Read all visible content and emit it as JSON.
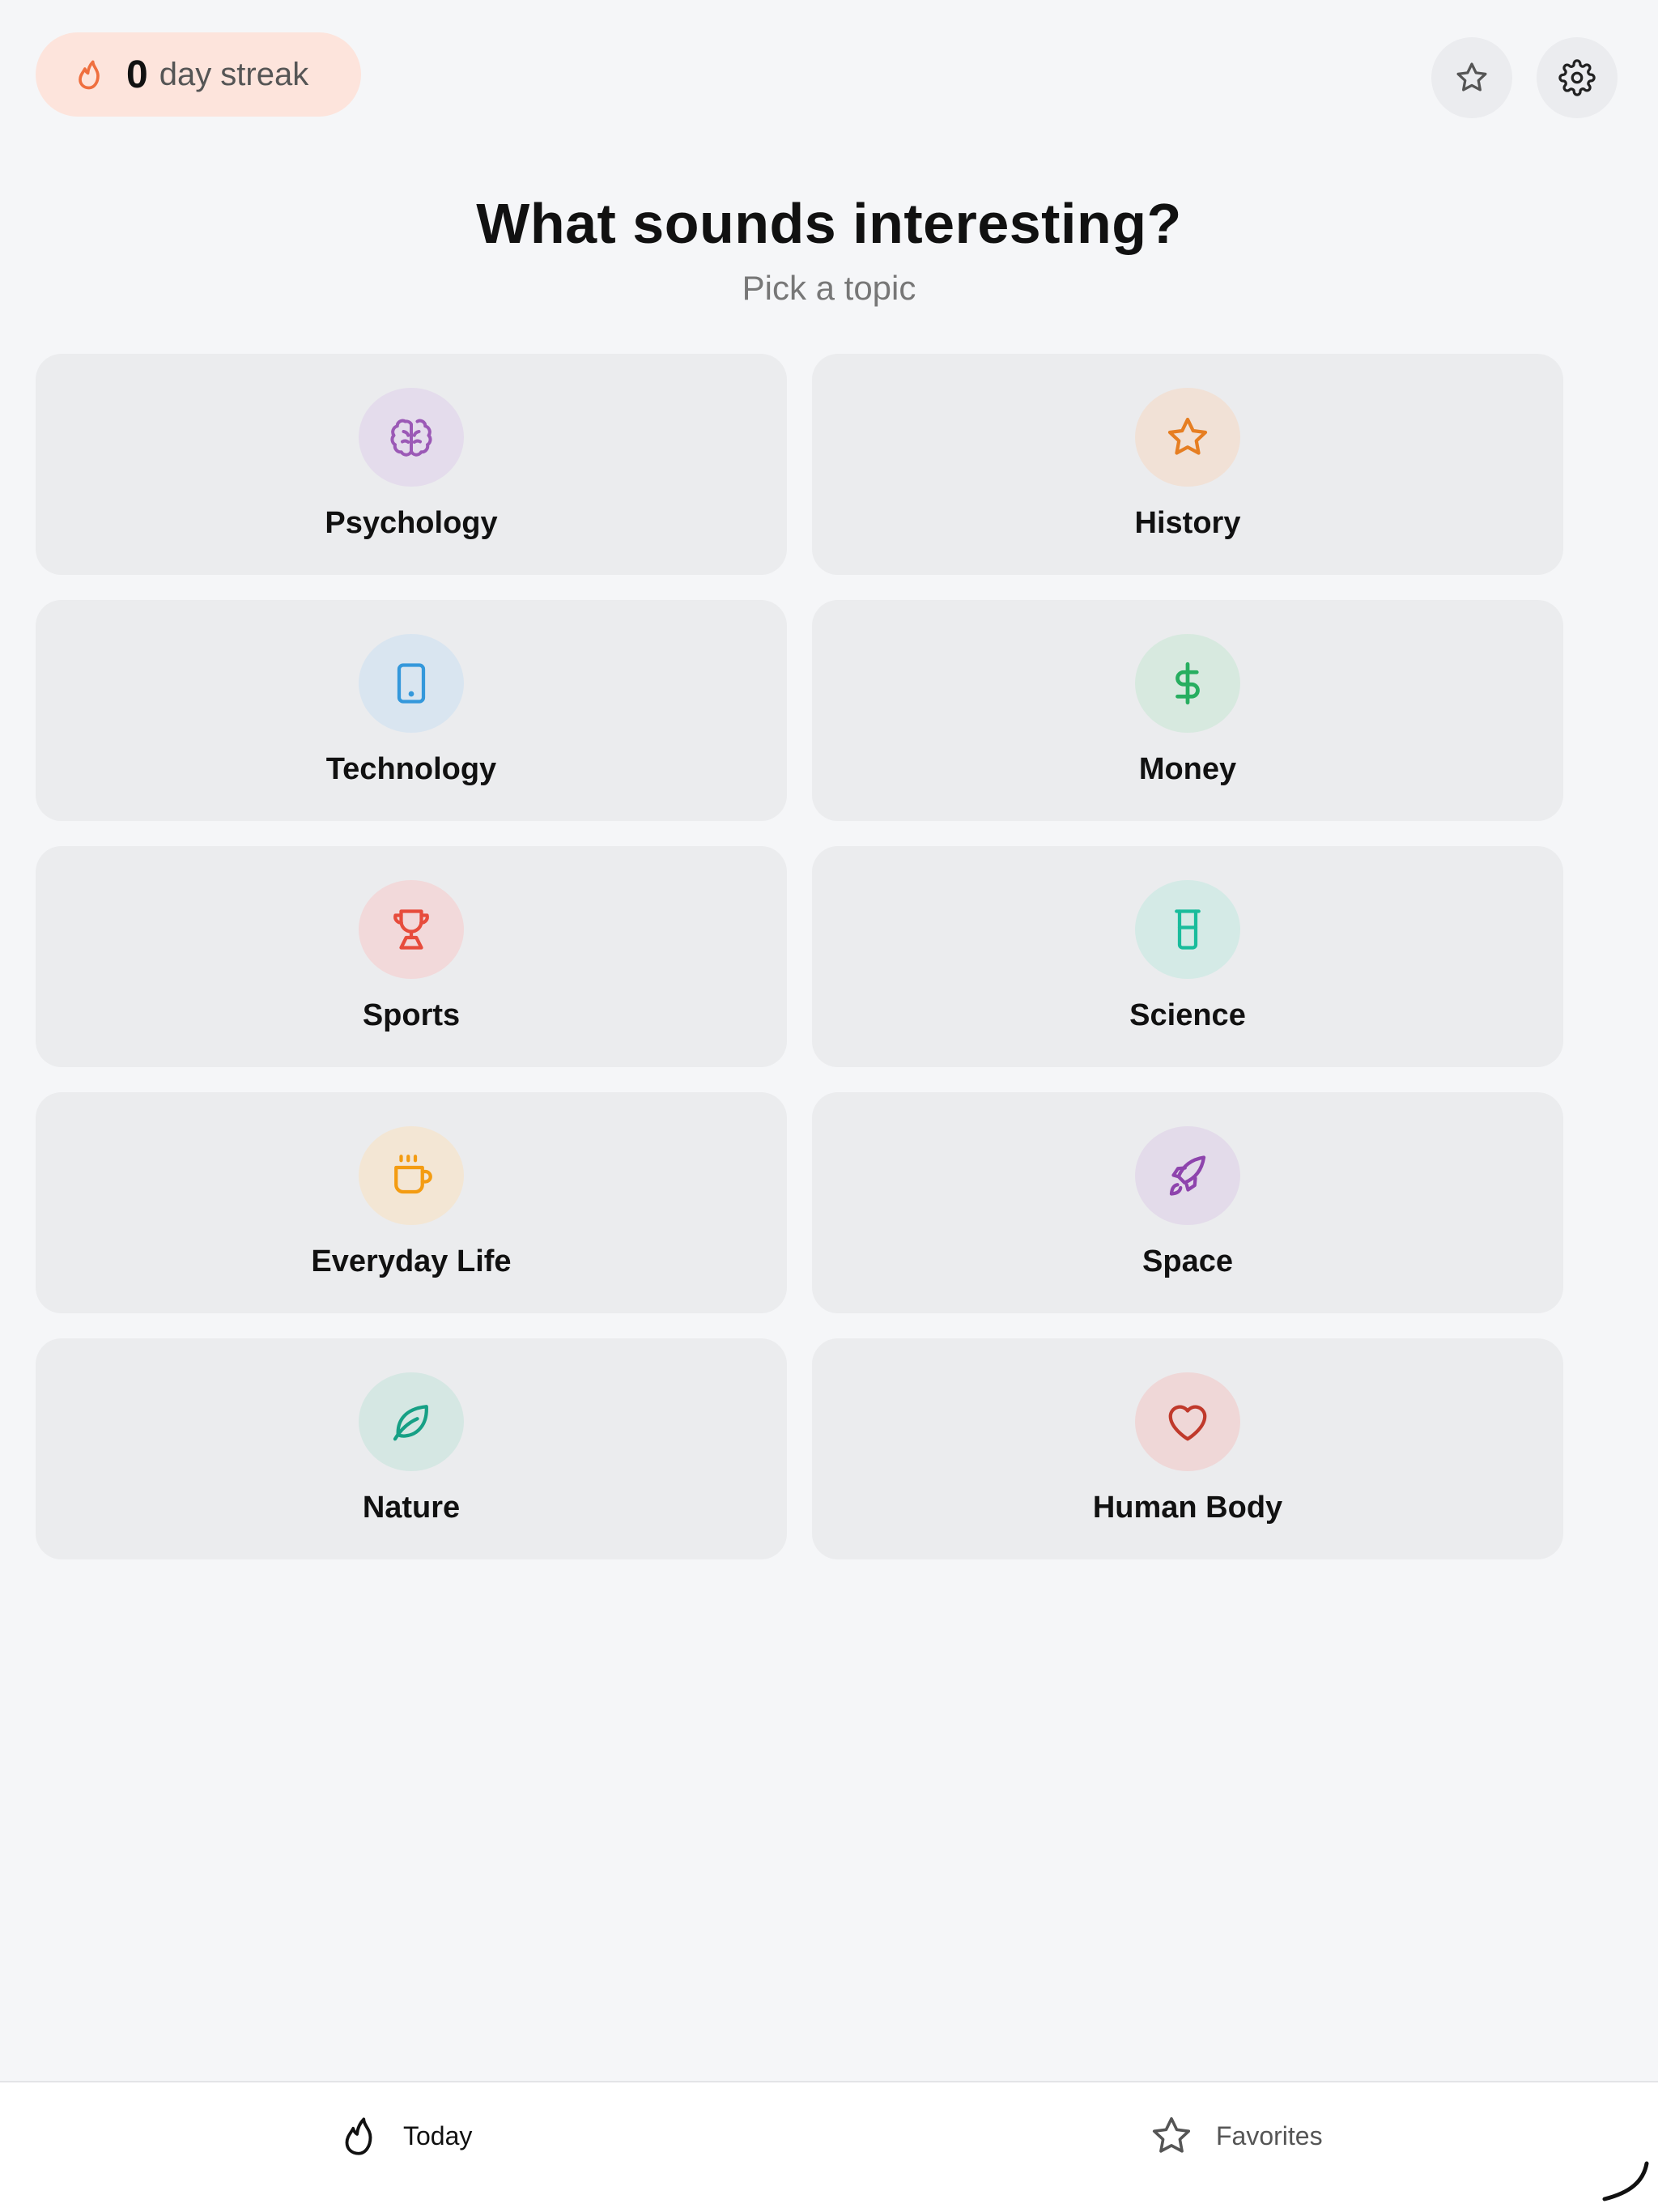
{
  "streak": {
    "count": "0",
    "label": "day streak",
    "icon": "flame-icon",
    "pill_color": "#fde4dc",
    "icon_color": "#ef6f3f"
  },
  "header_actions": [
    {
      "name": "favorites",
      "icon": "star-icon"
    },
    {
      "name": "settings",
      "icon": "gear-icon"
    }
  ],
  "page": {
    "title": "What sounds interesting?",
    "subtitle": "Pick a topic"
  },
  "topics": [
    {
      "label": "Psychology",
      "icon": "brain-icon",
      "color": "#9b59b6",
      "bg": "#e4dcec"
    },
    {
      "label": "History",
      "icon": "star-icon",
      "color": "#e67e22",
      "bg": "#f1e1d6"
    },
    {
      "label": "Technology",
      "icon": "tablet-icon",
      "color": "#3498db",
      "bg": "#d9e5f0"
    },
    {
      "label": "Money",
      "icon": "dollar-icon",
      "color": "#27ae60",
      "bg": "#d7e9df"
    },
    {
      "label": "Sports",
      "icon": "trophy-icon",
      "color": "#e74c3c",
      "bg": "#f2d9da"
    },
    {
      "label": "Science",
      "icon": "beaker-icon",
      "color": "#1abc9c",
      "bg": "#d4eae6"
    },
    {
      "label": "Everyday Life",
      "icon": "coffee-icon",
      "color": "#f39c12",
      "bg": "#f3e6d4"
    },
    {
      "label": "Space",
      "icon": "rocket-icon",
      "color": "#8e44ad",
      "bg": "#e3dbea"
    },
    {
      "label": "Nature",
      "icon": "leaf-icon",
      "color": "#16a085",
      "bg": "#d5e7e3"
    },
    {
      "label": "Human Body",
      "icon": "heart-icon",
      "color": "#c0392b",
      "bg": "#efd7d7"
    }
  ],
  "bottom_nav": {
    "today": {
      "label": "Today",
      "icon": "flame-icon",
      "active": true
    },
    "favorites": {
      "label": "Favorites",
      "icon": "star-icon",
      "active": false
    }
  }
}
